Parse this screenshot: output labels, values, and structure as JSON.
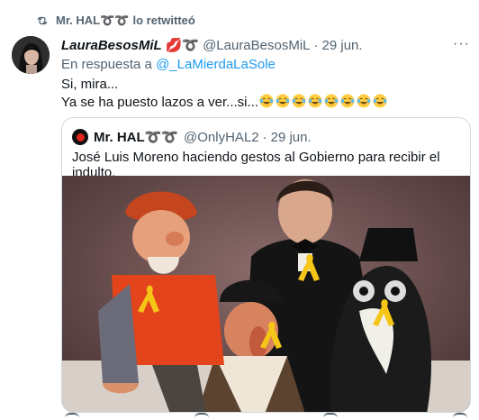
{
  "retweet": {
    "icon": "retweet-icon",
    "user": "Mr. HAL➰➰",
    "suffix": "lo retwitteó"
  },
  "tweet": {
    "display_name": "LauraBesosMiL",
    "name_emoji": "💋➰",
    "handle": "@LauraBesosMiL",
    "separator": "·",
    "date": "29 jun.",
    "reply_prefix": "En respuesta a",
    "reply_mention": "@_LaMierdaLaSole",
    "line1": "Si, mira...",
    "line2": "Ya se ha puesto lazos a ver...si...",
    "emoji_count": 8,
    "more_label": "···"
  },
  "quote": {
    "display_name": "Mr. HAL➰➰",
    "handle": "@OnlyHAL2",
    "separator": "·",
    "date": "29 jun.",
    "text": "José Luis Moreno haciendo gestos al Gobierno para recibir el indulto."
  },
  "colors": {
    "link": "#1d9bf0",
    "secondary": "#536471",
    "text": "#0f1419",
    "border": "#cfd9de",
    "ribbon": "#f5c518"
  }
}
